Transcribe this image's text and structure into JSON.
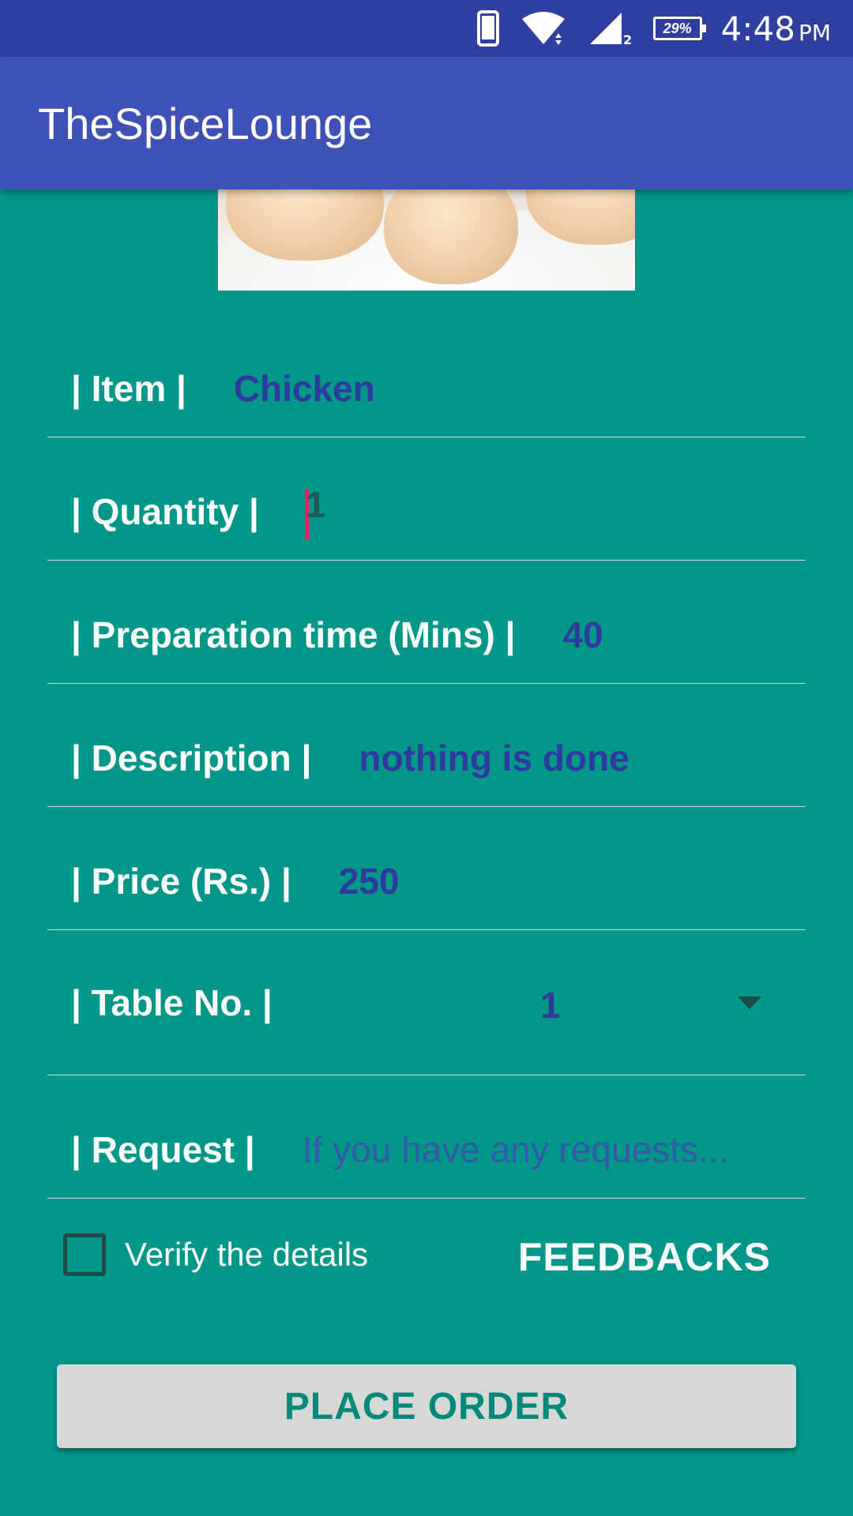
{
  "status_bar": {
    "battery": "29%",
    "time": "4:48",
    "ampm": "PM",
    "icons": [
      "phone-icon",
      "wifi-icon",
      "signal-icon",
      "battery-icon"
    ]
  },
  "app_bar": {
    "title": "TheSpiceLounge"
  },
  "image": {
    "subject": "food-photo"
  },
  "form": {
    "item": {
      "label": "| Item |",
      "value": "Chicken"
    },
    "quantity": {
      "label": "| Quantity |",
      "value": "1"
    },
    "prep_time": {
      "label": "| Preparation time (Mins) |",
      "value": "40"
    },
    "description": {
      "label": "| Description |",
      "value": "nothing is done"
    },
    "price": {
      "label": "| Price (Rs.) |",
      "value": "250"
    },
    "table": {
      "label": "| Table No. |",
      "value": "1"
    },
    "request": {
      "label": "| Request |",
      "placeholder": "If you have any requests..."
    }
  },
  "verify": {
    "label": "Verify the details",
    "checked": false
  },
  "feedbacks_label": "FEEDBACKS",
  "place_order_label": "PLACE ORDER",
  "colors": {
    "status_bar": "#303f9f",
    "app_bar": "#3f51b5",
    "background": "#009688",
    "value_text": "#2f3a9e",
    "cursor": "#e91e63",
    "button_bg": "#d6d7d7",
    "button_text": "#00897b"
  }
}
